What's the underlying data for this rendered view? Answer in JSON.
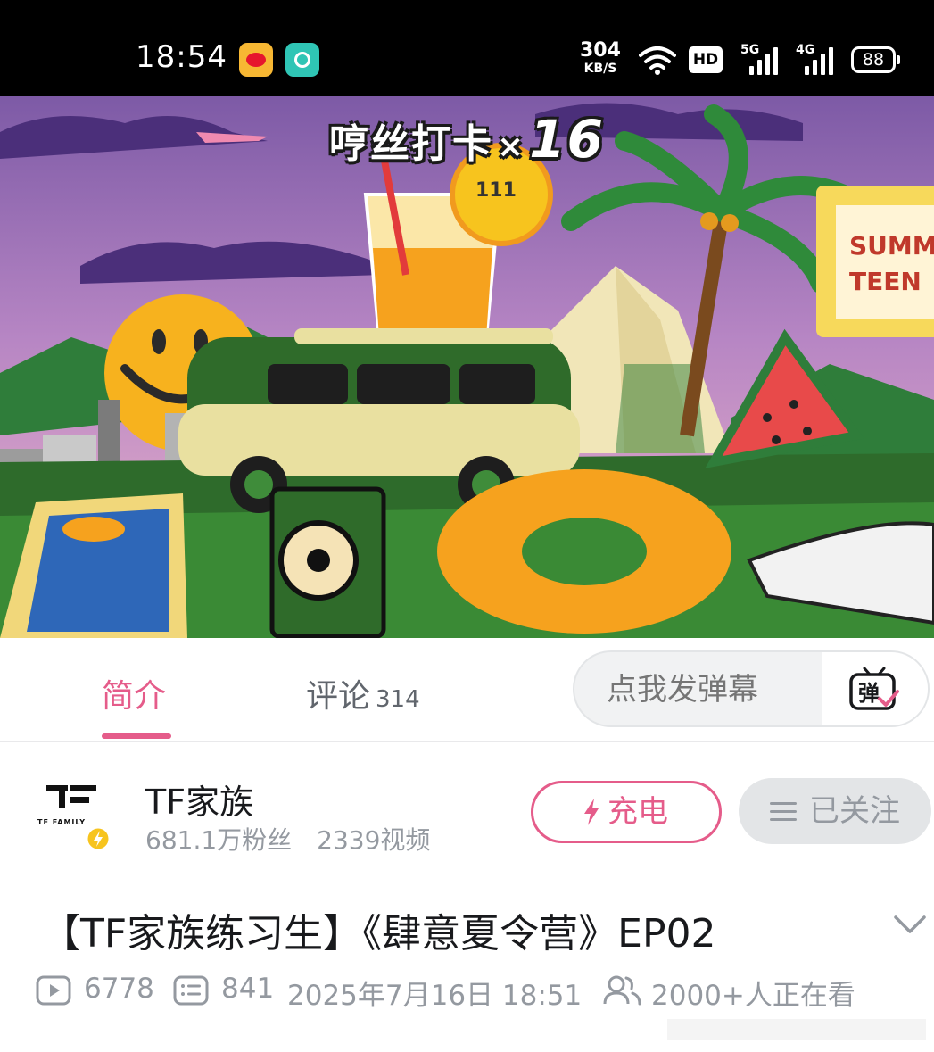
{
  "status_bar": {
    "time": "18:54",
    "net_speed": "304",
    "net_speed_unit": "KB/S",
    "hd_label": "HD",
    "signal_1": "5G",
    "signal_2": "4G",
    "battery": "88"
  },
  "video": {
    "danmaku_text": "哼丝打卡",
    "danmaku_times": "×",
    "danmaku_count": "16",
    "lemon_text": "111",
    "sign_line_1": "SUMME",
    "sign_line_2": "TEEN"
  },
  "tabs": {
    "intro": "简介",
    "comments": "评论",
    "comments_count": "314",
    "danmaku_placeholder": "点我发弹幕",
    "danmaku_icon_glyph": "弹"
  },
  "uploader": {
    "name": "TF家族",
    "fans": "681.1万粉丝",
    "videos": "2339视频",
    "logo_text": "TF FAMILY",
    "charge_label": "充电",
    "follow_label": "已关注"
  },
  "video_info": {
    "title": "【TF家族练习生】《肆意夏令营》EP02",
    "plays": "6778",
    "danmaku": "841",
    "pubdate": "2025年7月16日 18:51",
    "watching": "2000+人正在看"
  },
  "colors": {
    "accent": "#e55c8a",
    "gray_text": "#9499a0",
    "statusbar_bg": "#000000"
  }
}
